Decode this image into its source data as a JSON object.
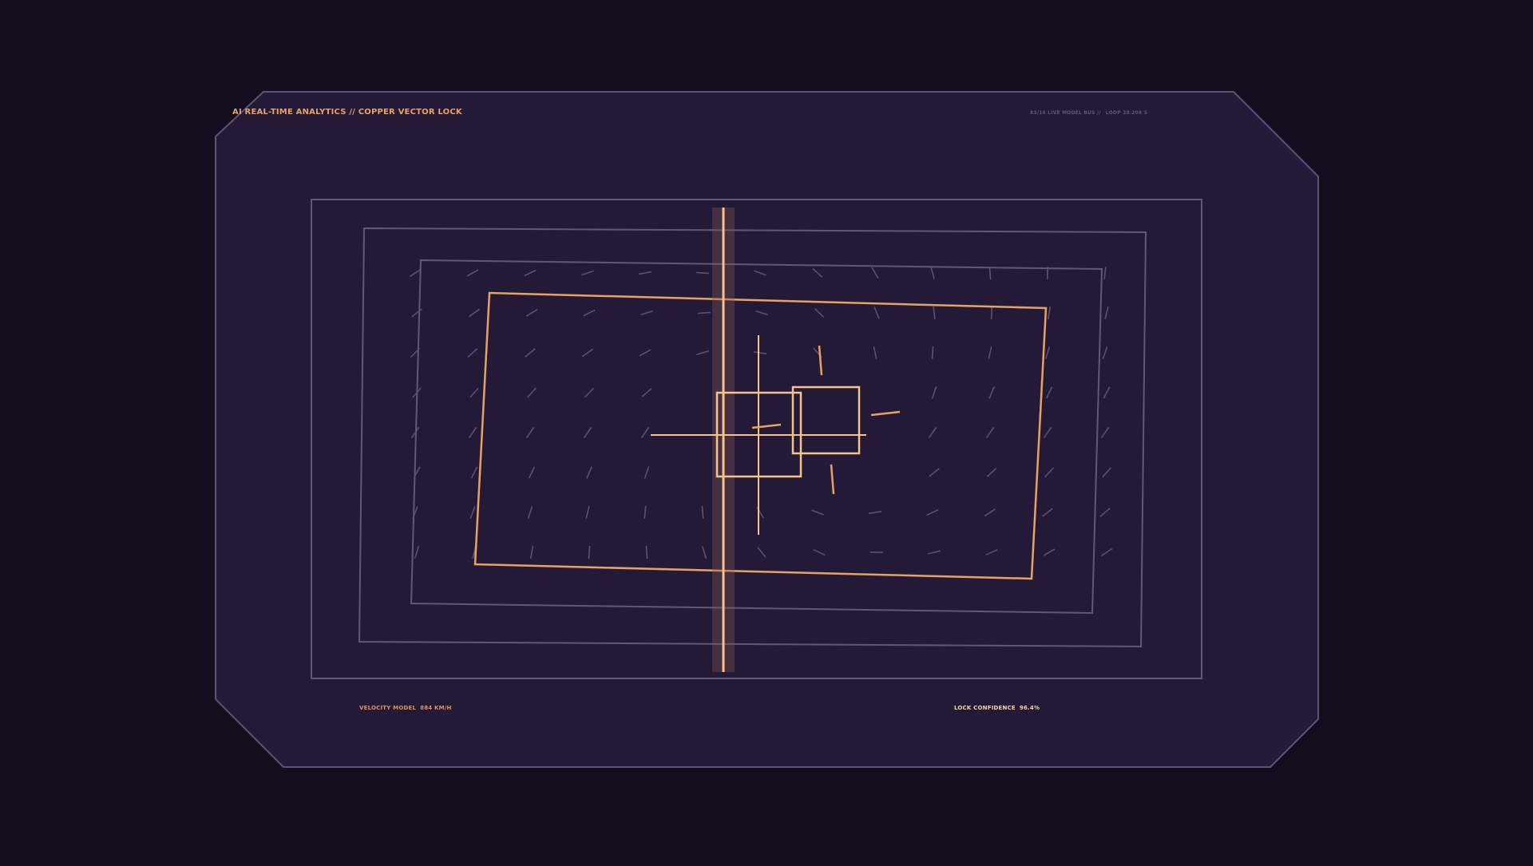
{
  "hud": {
    "title": "AI REAL-TIME ANALYTICS // COPPER VECTOR LOCK",
    "meta": {
      "model_label": "83/16  LIVE MODEL BUS  //",
      "loop_label": "LOOP 38.206 S"
    },
    "velocity": {
      "label": "VELOCITY MODEL",
      "value": "884 KM/H"
    },
    "confidence": {
      "label": "LOCK CONFIDENCE",
      "value": "96.4%"
    }
  },
  "colors": {
    "background": "#120e1e",
    "panel_fill": "#241a38",
    "panel_stroke": "#5d5575",
    "copper": "#e6a363",
    "copper_light": "#f4c489",
    "frame_gray": "#605874",
    "vector_gray": "#5a5270"
  }
}
